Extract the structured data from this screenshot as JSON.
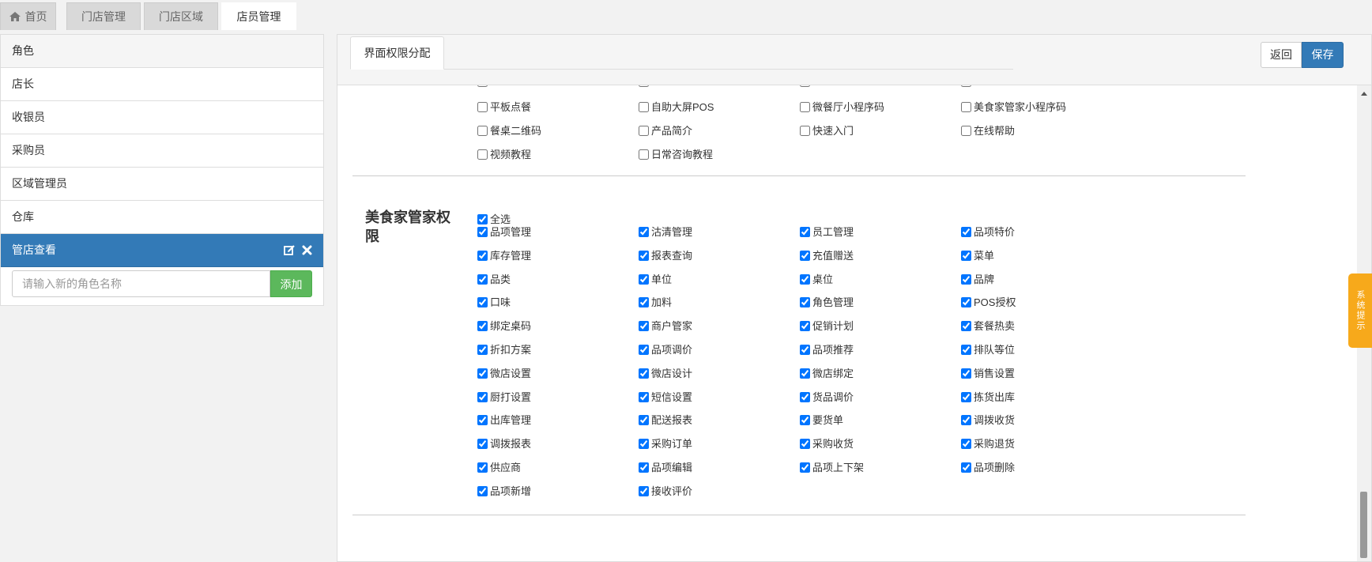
{
  "tabs": [
    {
      "label": "首页",
      "icon": "home-icon",
      "active": false
    },
    {
      "label": "门店管理",
      "active": false
    },
    {
      "label": "门店区域",
      "active": false
    },
    {
      "label": "店员管理",
      "active": true
    }
  ],
  "roles": {
    "header": "角色",
    "items": [
      "店长",
      "收银员",
      "采购员",
      "区域管理员",
      "仓库",
      "管店查看"
    ],
    "active_index": 5,
    "active_actions": [
      "edit-icon",
      "close-icon"
    ],
    "new_role_placeholder": "请输入新的角色名称",
    "add_label": "添加"
  },
  "permissions": {
    "tab_label": "界面权限分配",
    "back_label": "返回",
    "save_label": "保存",
    "top_section_items": [
      {
        "label": "平板点餐",
        "checked": false
      },
      {
        "label": "自助大屏POS",
        "checked": false
      },
      {
        "label": "微餐厅小程序码",
        "checked": false
      },
      {
        "label": "美食家管家小程序码",
        "checked": false
      },
      {
        "label": "餐桌二维码",
        "checked": false
      },
      {
        "label": "产品简介",
        "checked": false
      },
      {
        "label": "快速入门",
        "checked": false
      },
      {
        "label": "在线帮助",
        "checked": false
      },
      {
        "label": "视频教程",
        "checked": false
      },
      {
        "label": "日常咨询教程",
        "checked": false
      }
    ],
    "section_title": "美食家管家权限",
    "select_all_label": "全选",
    "select_all_checked": true,
    "items": [
      {
        "label": "品项管理",
        "checked": true
      },
      {
        "label": "沽清管理",
        "checked": true
      },
      {
        "label": "员工管理",
        "checked": true
      },
      {
        "label": "品项特价",
        "checked": true
      },
      {
        "label": "库存管理",
        "checked": true
      },
      {
        "label": "报表查询",
        "checked": true
      },
      {
        "label": "充值赠送",
        "checked": true
      },
      {
        "label": "菜单",
        "checked": true
      },
      {
        "label": "品类",
        "checked": true
      },
      {
        "label": "单位",
        "checked": true
      },
      {
        "label": "桌位",
        "checked": true
      },
      {
        "label": "品牌",
        "checked": true
      },
      {
        "label": "口味",
        "checked": true
      },
      {
        "label": "加料",
        "checked": true
      },
      {
        "label": "角色管理",
        "checked": true
      },
      {
        "label": "POS授权",
        "checked": true
      },
      {
        "label": "绑定桌码",
        "checked": true
      },
      {
        "label": "商户管家",
        "checked": true
      },
      {
        "label": "促销计划",
        "checked": true
      },
      {
        "label": "套餐热卖",
        "checked": true
      },
      {
        "label": "折扣方案",
        "checked": true
      },
      {
        "label": "品项调价",
        "checked": true
      },
      {
        "label": "品项推荐",
        "checked": true
      },
      {
        "label": "排队等位",
        "checked": true
      },
      {
        "label": "微店设置",
        "checked": true
      },
      {
        "label": "微店设计",
        "checked": true
      },
      {
        "label": "微店绑定",
        "checked": true
      },
      {
        "label": "销售设置",
        "checked": true
      },
      {
        "label": "厨打设置",
        "checked": true
      },
      {
        "label": "短信设置",
        "checked": true
      },
      {
        "label": "货品调价",
        "checked": true
      },
      {
        "label": "拣货出库",
        "checked": true
      },
      {
        "label": "出库管理",
        "checked": true
      },
      {
        "label": "配送报表",
        "checked": true
      },
      {
        "label": "要货单",
        "checked": true
      },
      {
        "label": "调拨收货",
        "checked": true
      },
      {
        "label": "调拨报表",
        "checked": true
      },
      {
        "label": "采购订单",
        "checked": true
      },
      {
        "label": "采购收货",
        "checked": true
      },
      {
        "label": "采购退货",
        "checked": true
      },
      {
        "label": "供应商",
        "checked": true
      },
      {
        "label": "品项编辑",
        "checked": true
      },
      {
        "label": "品项上下架",
        "checked": true
      },
      {
        "label": "品项删除",
        "checked": true
      },
      {
        "label": "品项新增",
        "checked": true
      },
      {
        "label": "接收评价",
        "checked": true
      }
    ]
  },
  "side_hint": "系统提示",
  "colors": {
    "primary": "#337ab7",
    "success": "#5cb85c",
    "hint": "#f7a91b"
  }
}
